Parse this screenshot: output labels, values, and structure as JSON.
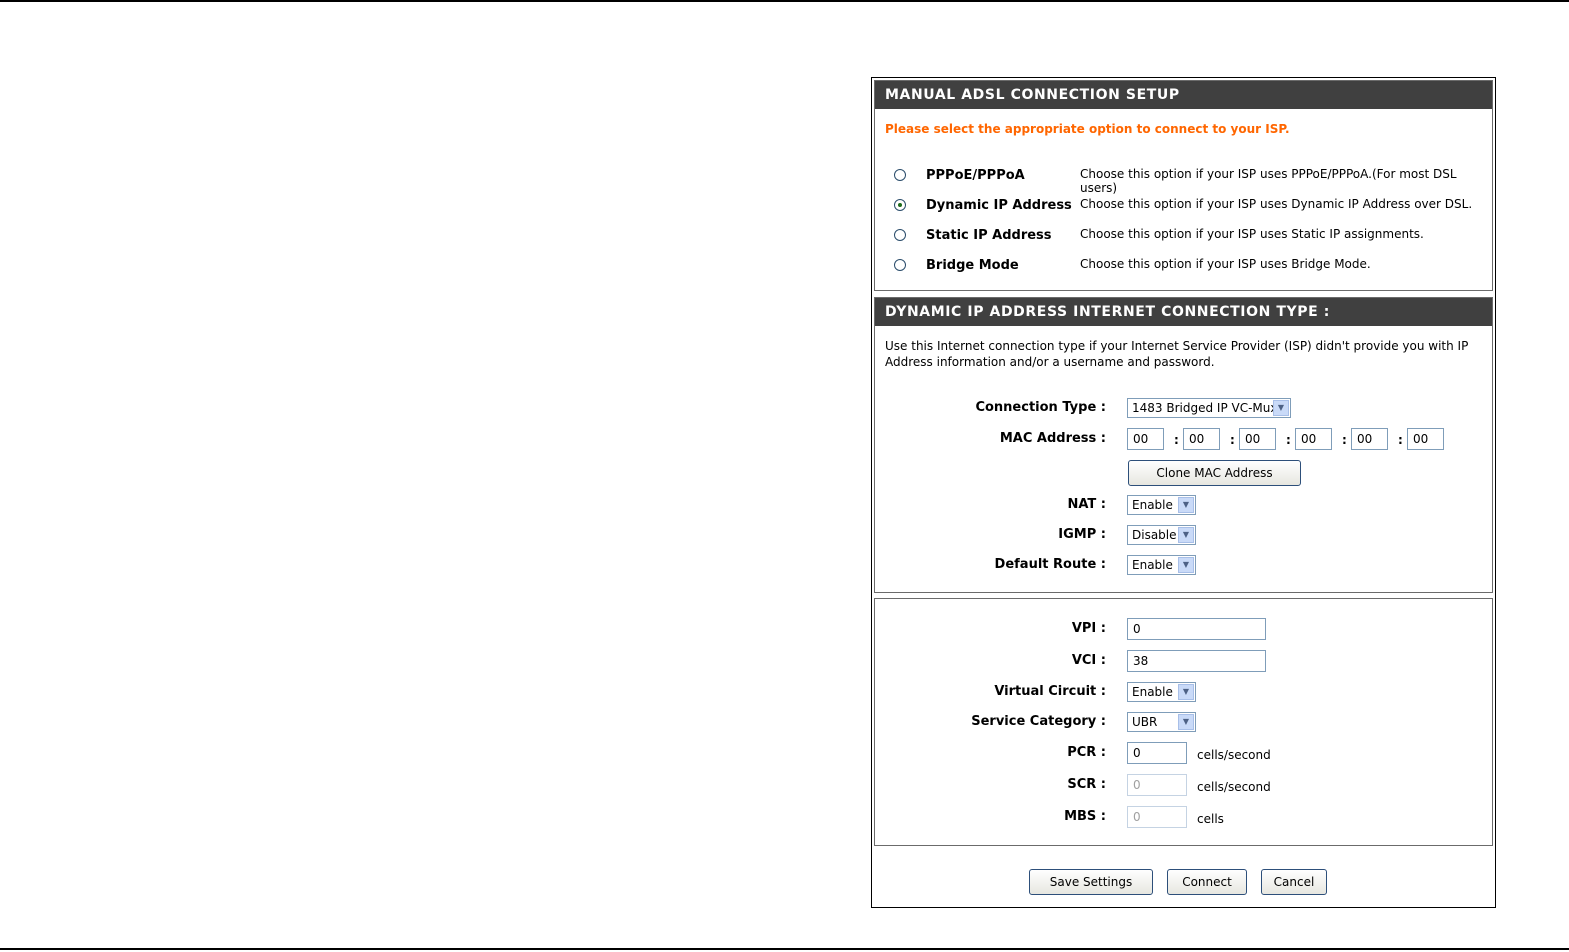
{
  "setup": {
    "header": "MANUAL ADSL CONNECTION SETUP",
    "prompt": "Please select the appropriate option to connect to your ISP.",
    "options": [
      {
        "label": "PPPoE/PPPoA",
        "desc": "Choose this option if your ISP uses PPPoE/PPPoA.(For most DSL users)",
        "selected": false
      },
      {
        "label": "Dynamic IP Address",
        "desc": "Choose this option if your ISP uses Dynamic IP Address over DSL.",
        "selected": true
      },
      {
        "label": "Static IP Address",
        "desc": "Choose this option if your ISP uses Static IP assignments.",
        "selected": false
      },
      {
        "label": "Bridge Mode",
        "desc": "Choose this option if your ISP uses Bridge Mode.",
        "selected": false
      }
    ]
  },
  "dynamic": {
    "header": "DYNAMIC IP ADDRESS INTERNET CONNECTION TYPE :",
    "description": "Use this Internet connection type if your Internet Service Provider (ISP) didn't provide you with IP Address information and/or a username and password.",
    "connection_type_label": "Connection Type :",
    "connection_type_value": "1483 Bridged IP VC-Mux",
    "mac_label": "MAC Address :",
    "mac_values": [
      "00",
      "00",
      "00",
      "00",
      "00",
      "00"
    ],
    "mac_separator": ":",
    "clone_button": "Clone MAC Address",
    "nat_label": "NAT :",
    "nat_value": "Enable",
    "igmp_label": "IGMP :",
    "igmp_value": "Disable",
    "route_label": "Default Route :",
    "route_value": "Enable"
  },
  "atm": {
    "vpi_label": "VPI :",
    "vpi_value": "0",
    "vci_label": "VCI :",
    "vci_value": "38",
    "vc_label": "Virtual Circuit :",
    "vc_value": "Enable",
    "svc_label": "Service Category :",
    "svc_value": "UBR",
    "pcr_label": "PCR :",
    "pcr_value": "0",
    "pcr_unit": "cells/second",
    "scr_label": "SCR :",
    "scr_value": "0",
    "scr_unit": "cells/second",
    "mbs_label": "MBS :",
    "mbs_value": "0",
    "mbs_unit": "cells"
  },
  "actions": {
    "save": "Save Settings",
    "connect": "Connect",
    "cancel": "Cancel"
  },
  "colors": {
    "header_bg": "#404040",
    "prompt": "#ff6600"
  }
}
